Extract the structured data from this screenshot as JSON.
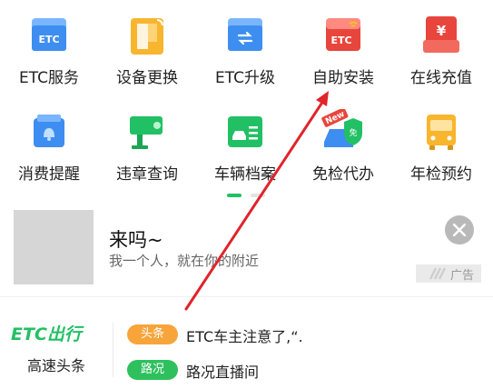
{
  "grid": {
    "row1": [
      {
        "label": "ETC服务",
        "icon": "etc-card-icon",
        "text": "ETC"
      },
      {
        "label": "设备更换",
        "icon": "device-swap-icon",
        "text": ""
      },
      {
        "label": "ETC升级",
        "icon": "etc-upgrade-icon",
        "text": ""
      },
      {
        "label": "自助安装",
        "icon": "etc-device-icon",
        "text": "ETC"
      },
      {
        "label": "在线充值",
        "icon": "recharge-icon",
        "text": "¥"
      }
    ],
    "row2": [
      {
        "label": "消费提醒",
        "icon": "reminder-icon"
      },
      {
        "label": "违章查询",
        "icon": "camera-icon"
      },
      {
        "label": "车辆档案",
        "icon": "vehicle-file-icon"
      },
      {
        "label": "免检代办",
        "icon": "exemption-icon",
        "badge": "New",
        "shield": "免"
      },
      {
        "label": "年检预约",
        "icon": "bus-icon"
      }
    ]
  },
  "ad": {
    "title": "来吗~",
    "subtitle": "我一个人，就在你的附近",
    "tag": "广告"
  },
  "news": {
    "brand": "高速头条",
    "logo_text": "ETC出行",
    "items": [
      {
        "tag": "头条",
        "text": "ETC车主注意了,“."
      },
      {
        "tag": "路况",
        "text": "路况直播间"
      }
    ]
  },
  "colors": {
    "green": "#22c064",
    "blue": "#3d8ef0",
    "orange": "#f7a43b",
    "red": "#e8453c",
    "arrow": "#e0242a"
  }
}
